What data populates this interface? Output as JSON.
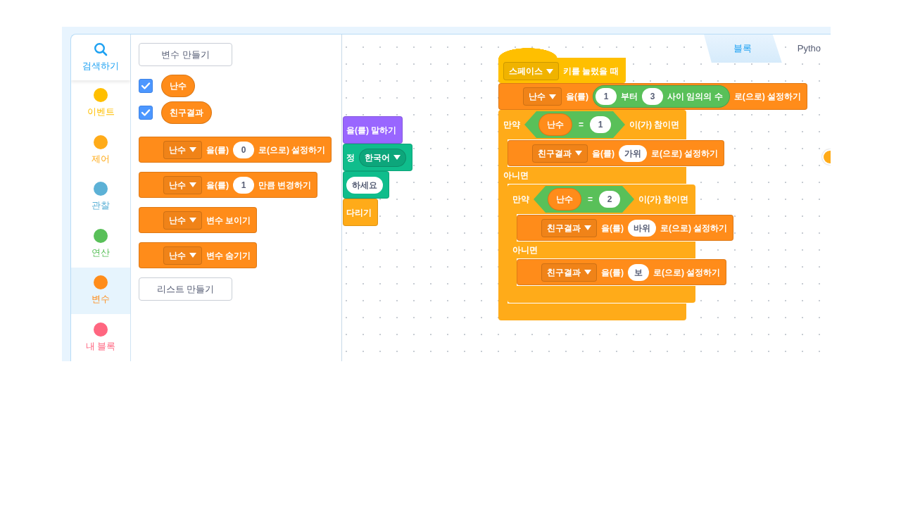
{
  "sidebar": {
    "items": [
      {
        "kind": "search",
        "label": "검색하기",
        "selected": false
      },
      {
        "kind": "category",
        "label": "이벤트",
        "color": "#ffbf00",
        "selected": false
      },
      {
        "kind": "category",
        "label": "제어",
        "color": "#ffab19",
        "selected": false
      },
      {
        "kind": "category",
        "label": "관찰",
        "color": "#5cb1d6",
        "selected": false
      },
      {
        "kind": "category",
        "label": "연산",
        "color": "#59c059",
        "selected": false
      },
      {
        "kind": "category",
        "label": "변수",
        "color": "#ff8c1a",
        "selected": true
      },
      {
        "kind": "category",
        "label": "내 블록",
        "color": "#ff6680",
        "selected": false
      }
    ]
  },
  "palette": {
    "items": [
      {
        "kind": "button",
        "label": "변수 만들기"
      },
      {
        "kind": "variable",
        "name": "난수",
        "checked": true
      },
      {
        "kind": "variable",
        "name": "친구결과",
        "checked": true
      },
      {
        "kind": "block",
        "block": {
          "kind": "stack",
          "color": "#ff8c1a",
          "parts": [
            {
              "kind": "dropdown",
              "text": "난수"
            },
            {
              "kind": "text",
              "text": "을(를)"
            },
            {
              "kind": "input",
              "text": "0"
            },
            {
              "kind": "text",
              "text": "로(으로) 설정하기"
            }
          ]
        }
      },
      {
        "kind": "block",
        "block": {
          "kind": "stack",
          "color": "#ff8c1a",
          "parts": [
            {
              "kind": "dropdown",
              "text": "난수"
            },
            {
              "kind": "text",
              "text": "을(를)"
            },
            {
              "kind": "input",
              "text": "1"
            },
            {
              "kind": "text",
              "text": "만큼 변경하기"
            }
          ]
        }
      },
      {
        "kind": "block",
        "block": {
          "kind": "stack",
          "color": "#ff8c1a",
          "parts": [
            {
              "kind": "dropdown",
              "text": "난수"
            },
            {
              "kind": "text",
              "text": "변수 보이기"
            }
          ]
        }
      },
      {
        "kind": "block",
        "block": {
          "kind": "stack",
          "color": "#ff8c1a",
          "parts": [
            {
              "kind": "dropdown",
              "text": "난수"
            },
            {
              "kind": "text",
              "text": "변수 숨기기"
            }
          ]
        }
      },
      {
        "kind": "button",
        "label": "리스트 만들기"
      }
    ]
  },
  "tabs": [
    {
      "label": "블록",
      "selected": true
    },
    {
      "label": "Pytho",
      "selected": false
    }
  ],
  "scripts": [
    {
      "blocks": [
        {
          "kind": "stack",
          "color": "#9966ff",
          "parts": [
            {
              "kind": "text",
              "text": "을(를) 말하기"
            }
          ]
        },
        {
          "kind": "stack",
          "color": "#0fbd8c",
          "parts": [
            {
              "kind": "text",
              "text": "정"
            },
            {
              "kind": "menu",
              "text": "한국어"
            }
          ]
        },
        {
          "kind": "stack",
          "color": "#0fbd8c",
          "parts": [
            {
              "kind": "input",
              "text": "하세요"
            }
          ]
        },
        {
          "kind": "stack",
          "color": "#ffab19",
          "parts": [
            {
              "kind": "text",
              "text": "다리기"
            }
          ]
        }
      ]
    },
    {
      "blocks": [
        {
          "kind": "hat",
          "color": "#ffbf00",
          "parts": [
            {
              "kind": "dropdown",
              "text": "스페이스"
            },
            {
              "kind": "text",
              "text": "키를 눌렀을 때"
            }
          ]
        },
        {
          "kind": "stack",
          "color": "#ff8c1a",
          "parts": [
            {
              "kind": "dropdown",
              "text": "난수"
            },
            {
              "kind": "text",
              "text": "을(를)"
            },
            {
              "kind": "round",
              "color": "#59c059",
              "parts": [
                {
                  "kind": "input",
                  "text": "1"
                },
                {
                  "kind": "text",
                  "text": "부터"
                },
                {
                  "kind": "input",
                  "text": "3"
                },
                {
                  "kind": "text",
                  "text": "사이 임의의 수"
                }
              ]
            },
            {
              "kind": "text",
              "text": "로(으로) 설정하기"
            }
          ]
        },
        {
          "kind": "ifelse",
          "color": "#ffab19",
          "parts": [
            {
              "kind": "text",
              "text": "만약"
            },
            {
              "kind": "boolean",
              "color": "#59c059",
              "parts": [
                {
                  "kind": "reporter",
                  "color": "#ff8c1a",
                  "text": "난수"
                },
                {
                  "kind": "text",
                  "text": "="
                },
                {
                  "kind": "input",
                  "text": "1"
                }
              ]
            },
            {
              "kind": "text",
              "text": "이(가) 참이면"
            }
          ],
          "body": [
            {
              "kind": "stack",
              "color": "#ff8c1a",
              "parts": [
                {
                  "kind": "dropdown",
                  "text": "친구결과"
                },
                {
                  "kind": "text",
                  "text": "을(를)"
                },
                {
                  "kind": "input",
                  "text": "가위"
                },
                {
                  "kind": "text",
                  "text": "로(으로) 설정하기"
                }
              ]
            }
          ],
          "else_parts": [
            {
              "kind": "text",
              "text": "아니면"
            }
          ],
          "else_body": [
            {
              "kind": "ifelse",
              "color": "#ffab19",
              "parts": [
                {
                  "kind": "text",
                  "text": "만약"
                },
                {
                  "kind": "boolean",
                  "color": "#59c059",
                  "parts": [
                    {
                      "kind": "reporter",
                      "color": "#ff8c1a",
                      "text": "난수"
                    },
                    {
                      "kind": "text",
                      "text": "="
                    },
                    {
                      "kind": "input",
                      "text": "2"
                    }
                  ]
                },
                {
                  "kind": "text",
                  "text": "이(가) 참이면"
                }
              ],
              "body": [
                {
                  "kind": "stack",
                  "color": "#ff8c1a",
                  "parts": [
                    {
                      "kind": "dropdown",
                      "text": "친구결과"
                    },
                    {
                      "kind": "text",
                      "text": "을(를)"
                    },
                    {
                      "kind": "input",
                      "text": "바위"
                    },
                    {
                      "kind": "text",
                      "text": "로(으로) 설정하기"
                    }
                  ]
                }
              ],
              "else_parts": [
                {
                  "kind": "text",
                  "text": "아니면"
                }
              ],
              "else_body": [
                {
                  "kind": "stack",
                  "color": "#ff8c1a",
                  "parts": [
                    {
                      "kind": "dropdown",
                      "text": "친구결과"
                    },
                    {
                      "kind": "text",
                      "text": "을(를)"
                    },
                    {
                      "kind": "input",
                      "text": "보"
                    },
                    {
                      "kind": "text",
                      "text": "로(으로) 설정하기"
                    }
                  ]
                }
              ]
            }
          ]
        }
      ]
    }
  ]
}
